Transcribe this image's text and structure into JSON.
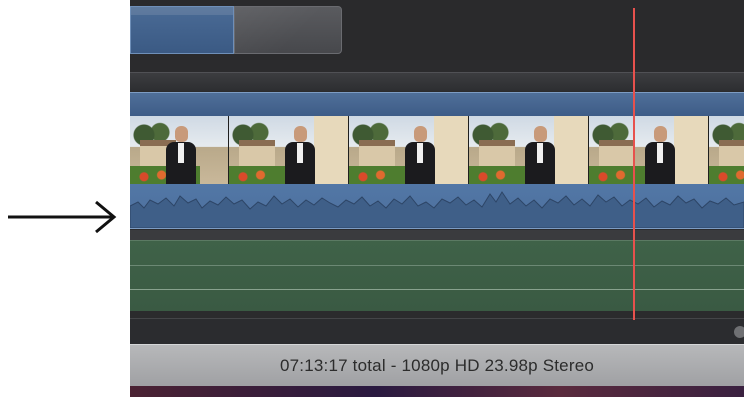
{
  "status_bar": {
    "summary": "07:13:17 total - 1080p HD 23.98p Stereo"
  },
  "colors": {
    "playhead": "#e7514d",
    "clip_blue": "#4d6f9c",
    "audio_green": "#3f6248",
    "status_bar": "#a9aaad"
  },
  "icons": {
    "annotation_arrow": "arrow-right-icon"
  }
}
